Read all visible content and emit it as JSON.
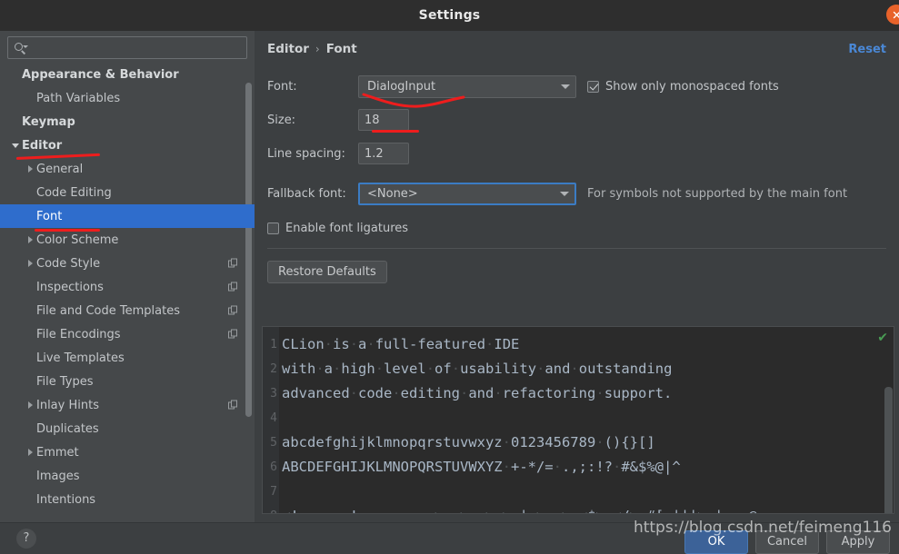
{
  "window": {
    "title": "Settings",
    "close_icon": "close-circle-icon"
  },
  "sidebar": {
    "search": {
      "placeholder": "",
      "value": "",
      "icon": "search-icon"
    },
    "items": [
      {
        "label": "Appearance & Behavior",
        "indent": 0,
        "bold": true,
        "twisty": "none",
        "badge": false
      },
      {
        "label": "Path Variables",
        "indent": 1,
        "bold": false,
        "twisty": "none",
        "badge": false
      },
      {
        "label": "Keymap",
        "indent": 0,
        "bold": true,
        "twisty": "none",
        "badge": false
      },
      {
        "label": "Editor",
        "indent": 0,
        "bold": true,
        "twisty": "down",
        "badge": false
      },
      {
        "label": "General",
        "indent": 1,
        "bold": false,
        "twisty": "right",
        "badge": false
      },
      {
        "label": "Code Editing",
        "indent": 1,
        "bold": false,
        "twisty": "none",
        "badge": false
      },
      {
        "label": "Font",
        "indent": 1,
        "bold": false,
        "twisty": "none",
        "badge": false,
        "selected": true
      },
      {
        "label": "Color Scheme",
        "indent": 1,
        "bold": false,
        "twisty": "right",
        "badge": false
      },
      {
        "label": "Code Style",
        "indent": 1,
        "bold": false,
        "twisty": "right",
        "badge": true
      },
      {
        "label": "Inspections",
        "indent": 1,
        "bold": false,
        "twisty": "none",
        "badge": true
      },
      {
        "label": "File and Code Templates",
        "indent": 1,
        "bold": false,
        "twisty": "none",
        "badge": true
      },
      {
        "label": "File Encodings",
        "indent": 1,
        "bold": false,
        "twisty": "none",
        "badge": true
      },
      {
        "label": "Live Templates",
        "indent": 1,
        "bold": false,
        "twisty": "none",
        "badge": false
      },
      {
        "label": "File Types",
        "indent": 1,
        "bold": false,
        "twisty": "none",
        "badge": false
      },
      {
        "label": "Inlay Hints",
        "indent": 1,
        "bold": false,
        "twisty": "right",
        "badge": true
      },
      {
        "label": "Duplicates",
        "indent": 1,
        "bold": false,
        "twisty": "none",
        "badge": false
      },
      {
        "label": "Emmet",
        "indent": 1,
        "bold": false,
        "twisty": "right",
        "badge": false
      },
      {
        "label": "Images",
        "indent": 1,
        "bold": false,
        "twisty": "none",
        "badge": false
      },
      {
        "label": "Intentions",
        "indent": 1,
        "bold": false,
        "twisty": "none",
        "badge": false
      }
    ]
  },
  "content": {
    "breadcrumb": {
      "parent": "Editor",
      "separator": "›",
      "current": "Font"
    },
    "reset_label": "Reset",
    "fields": {
      "font_label": "Font:",
      "font_value": "DialogInput",
      "monospaced_label": "Show only monospaced fonts",
      "monospaced_checked": true,
      "size_label": "Size:",
      "size_value": "18",
      "line_spacing_label": "Line spacing:",
      "line_spacing_value": "1.2",
      "fallback_label": "Fallback font:",
      "fallback_value": "<None>",
      "fallback_hint": "For symbols not supported by the main font",
      "ligatures_label": "Enable font ligatures",
      "ligatures_checked": false,
      "restore_defaults_label": "Restore Defaults"
    },
    "preview": {
      "status_icon": "green-check-icon",
      "lines": [
        {
          "no": "1",
          "text": "CLion·is·a·full-featured·IDE"
        },
        {
          "no": "2",
          "text": "with·a·high·level·of·usability·and·outstanding"
        },
        {
          "no": "3",
          "text": "advanced·code·editing·and·refactoring·support."
        },
        {
          "no": "4",
          "text": ""
        },
        {
          "no": "5",
          "text": "abcdefghijklmnopqrstuvwxyz·0123456789·(){}[]"
        },
        {
          "no": "6",
          "text": "ABCDEFGHIJKLMNOPQRSTUVWXYZ·+-*/=·.,;:!?·#&$%@|^"
        },
        {
          "no": "7",
          "text": ""
        },
        {
          "no": "8",
          "text": "<!--·--·!=·:=·===·>=·>-·>=>·|->·->·<$>·</>·#[·|||>·|=·~@"
        }
      ]
    }
  },
  "footer": {
    "help_label": "?",
    "ok_label": "OK",
    "cancel_label": "Cancel",
    "apply_label": "Apply"
  },
  "watermark": {
    "text": "https://blog.csdn.net/feimeng116"
  },
  "colors": {
    "accent_selection": "#2f6dcc",
    "link": "#4a88d6",
    "annotation_red": "#ee1d1d",
    "window_close": "#e8622a",
    "preview_bg": "#2b2b2b",
    "preview_text": "#a9b7c6",
    "ok_check": "#499c54"
  }
}
